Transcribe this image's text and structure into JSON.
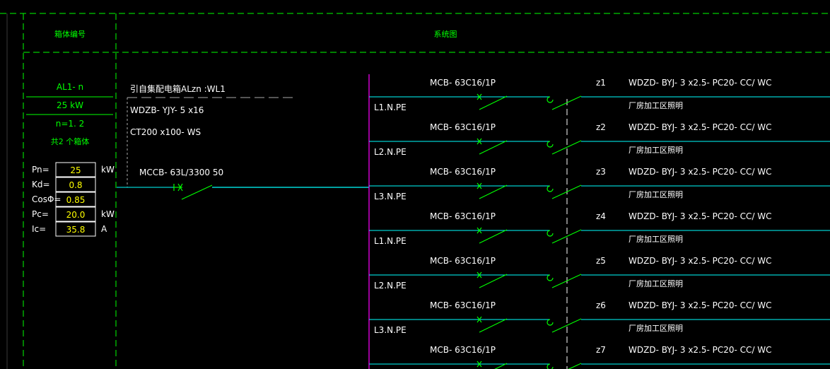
{
  "header": {
    "col1_title": "箱体编号",
    "col2_title": "系统图"
  },
  "panel": {
    "id": "AL1- n",
    "power": "25 kW",
    "count_n": "n=1. 2",
    "boxes_note": "共2 个箱体",
    "params": [
      {
        "label": "Pn=",
        "value": "25",
        "unit": "kW"
      },
      {
        "label": "Kd=",
        "value": "0.8",
        "unit": ""
      },
      {
        "label": "CosΦ=",
        "value": "0.85",
        "unit": ""
      },
      {
        "label": "Pc=",
        "value": "20.0",
        "unit": "kW"
      },
      {
        "label": "Ic=",
        "value": "35.8",
        "unit": "A"
      }
    ]
  },
  "incoming": {
    "line1": "引自集配电箱ALzn  :WL1",
    "line2": "WDZB- YJY- 5 x16",
    "line3": "CT200 x100- WS",
    "breaker": "MCCB- 63L/3300 50"
  },
  "circuits": [
    {
      "breaker": "MCB- 63C16/1P",
      "phase": "L1.N.PE",
      "id": "z1",
      "cable": "WDZD- BYJ- 3 x2.5- PC20- CC/ WC",
      "load": "厂房加工区照明"
    },
    {
      "breaker": "MCB- 63C16/1P",
      "phase": "L2.N.PE",
      "id": "z2",
      "cable": "WDZD- BYJ- 3 x2.5- PC20- CC/ WC",
      "load": "厂房加工区照明"
    },
    {
      "breaker": "MCB- 63C16/1P",
      "phase": "L3.N.PE",
      "id": "z3",
      "cable": "WDZD- BYJ- 3 x2.5- PC20- CC/ WC",
      "load": "厂房加工区照明"
    },
    {
      "breaker": "MCB- 63C16/1P",
      "phase": "L1.N.PE",
      "id": "z4",
      "cable": "WDZD- BYJ- 3 x2.5- PC20- CC/ WC",
      "load": "厂房加工区照明"
    },
    {
      "breaker": "MCB- 63C16/1P",
      "phase": "L2.N.PE",
      "id": "z5",
      "cable": "WDZD- BYJ- 3 x2.5- PC20- CC/ WC",
      "load": "厂房加工区照明"
    },
    {
      "breaker": "MCB- 63C16/1P",
      "phase": "L3.N.PE",
      "id": "z6",
      "cable": "WDZD- BYJ- 3 x2.5- PC20- CC/ WC",
      "load": "厂房加工区照明"
    },
    {
      "breaker": "MCB- 63C16/1P",
      "phase": "",
      "id": "z7",
      "cable": "WDZD- BYJ- 3 x2.5- PC20- CC/ WC",
      "load": ""
    }
  ],
  "colors": {
    "background": "#000000",
    "frame": "#00ff00",
    "text": "#ffffff",
    "bus": "#ff00ff",
    "circuit_line": "#00ffff",
    "breaker_symbol": "#00ff00",
    "param_value": "#ffff00"
  }
}
